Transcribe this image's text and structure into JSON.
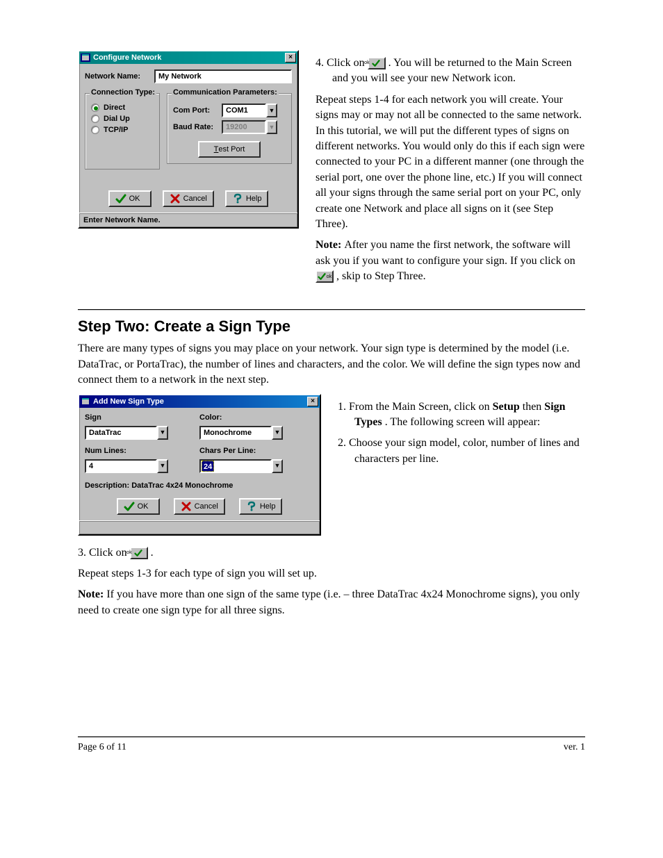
{
  "page": {
    "footer_left": "Page 6 of 11",
    "footer_right": "ver. 1"
  },
  "para1": {
    "t1": "4. Click on ",
    "t2": ". You will be returned to the Main Screen and you will see your new Network icon."
  },
  "para2": {
    "pre": "Repeat steps 1-4 for each network you will create. Your signs may or may not all be connected to the same network. In this tutorial, we will put the different types of signs on different networks. You would only do this if each sign were connected to your PC in a different manner (one through the serial port, one over the phone line, etc.) If you will connect all your signs through the same serial port on your PC, only create one Network and place all signs on it (see ",
    "link": "Step Three",
    "post": ")."
  },
  "noteA": {
    "lead": "Note: ",
    "t1": "After you name the first network, the software will ask you if you want to configure your sign. If you click on ",
    "t2": ", skip to ",
    "link": "Step Three",
    "t3": "."
  },
  "step2": {
    "heading": "Step Two: Create a Sign Type",
    "intro": "There are many types of signs you may place on your network. Your sign type is determined by the model (i.e. DataTrac, or PortaTrac), the number of lines and characters, and the color. We will define the sign types now and connect them to a network in the next step.",
    "s1a": "1. From the Main Screen, click on ",
    "s1b": "Setup ",
    "s1c": "then ",
    "s1d": "Sign Types",
    "s1e": ". The following screen will appear:",
    "s2": "2. Choose your sign model, color, number of lines and characters per line.",
    "s3a": "3. Click on ",
    "s3b": ".",
    "s4": "Repeat steps 1-3 for each type of sign you will set up.",
    "noteB": {
      "lead": "Note: ",
      "body": "If you have more than one sign of the same type (i.e. – three DataTrac 4x24 Monochrome signs), you only need to create one sign type for all three signs."
    }
  },
  "dlg1": {
    "title": "Configure Network",
    "network_name_label": "Network Name:",
    "network_name_value": "My Network",
    "grp_conn": "Connection Type:",
    "radio_direct": "Direct",
    "radio_dialup": "Dial Up",
    "radio_tcpip": "TCP/IP",
    "grp_comm": "Communication Parameters:",
    "com_port_label": "Com Port:",
    "com_port_value": "COM1",
    "baud_label": "Baud Rate:",
    "baud_value": "19200",
    "test_port": "Test Port",
    "ok": "OK",
    "cancel": "Cancel",
    "help": "Help",
    "status": "Enter Network Name."
  },
  "dlg2": {
    "title": "Add New Sign Type",
    "sign_label": "Sign",
    "sign_value": "DataTrac",
    "color_label": "Color:",
    "color_value": "Monochrome",
    "lines_label": "Num Lines:",
    "lines_value": "4",
    "cpl_label": "Chars Per Line:",
    "cpl_value": "24",
    "desc": "Description: DataTrac 4x24 Monochrome",
    "ok": "OK",
    "cancel": "Cancel",
    "help": "Help"
  },
  "icons": {
    "ok_mini": "ok"
  }
}
